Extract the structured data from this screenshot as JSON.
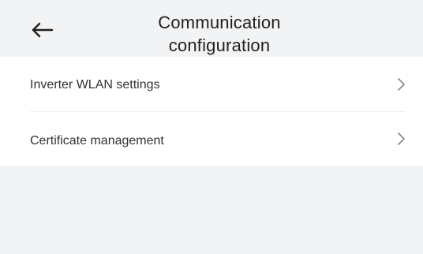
{
  "header": {
    "title_line1": "Communication",
    "title_line2": "configuration",
    "back_icon": "arrow-left-icon"
  },
  "menu": {
    "items": [
      {
        "label": "Inverter WLAN settings",
        "icon": "chevron-right-icon"
      },
      {
        "label": "Certificate management",
        "icon": "chevron-right-icon"
      }
    ]
  },
  "colors": {
    "page_background": "#f1f3f5",
    "card_background": "#ffffff",
    "text_primary": "#1f1f1f",
    "text_secondary": "#333333",
    "chevron": "#8c8c8c",
    "divider": "#eeeeee"
  }
}
